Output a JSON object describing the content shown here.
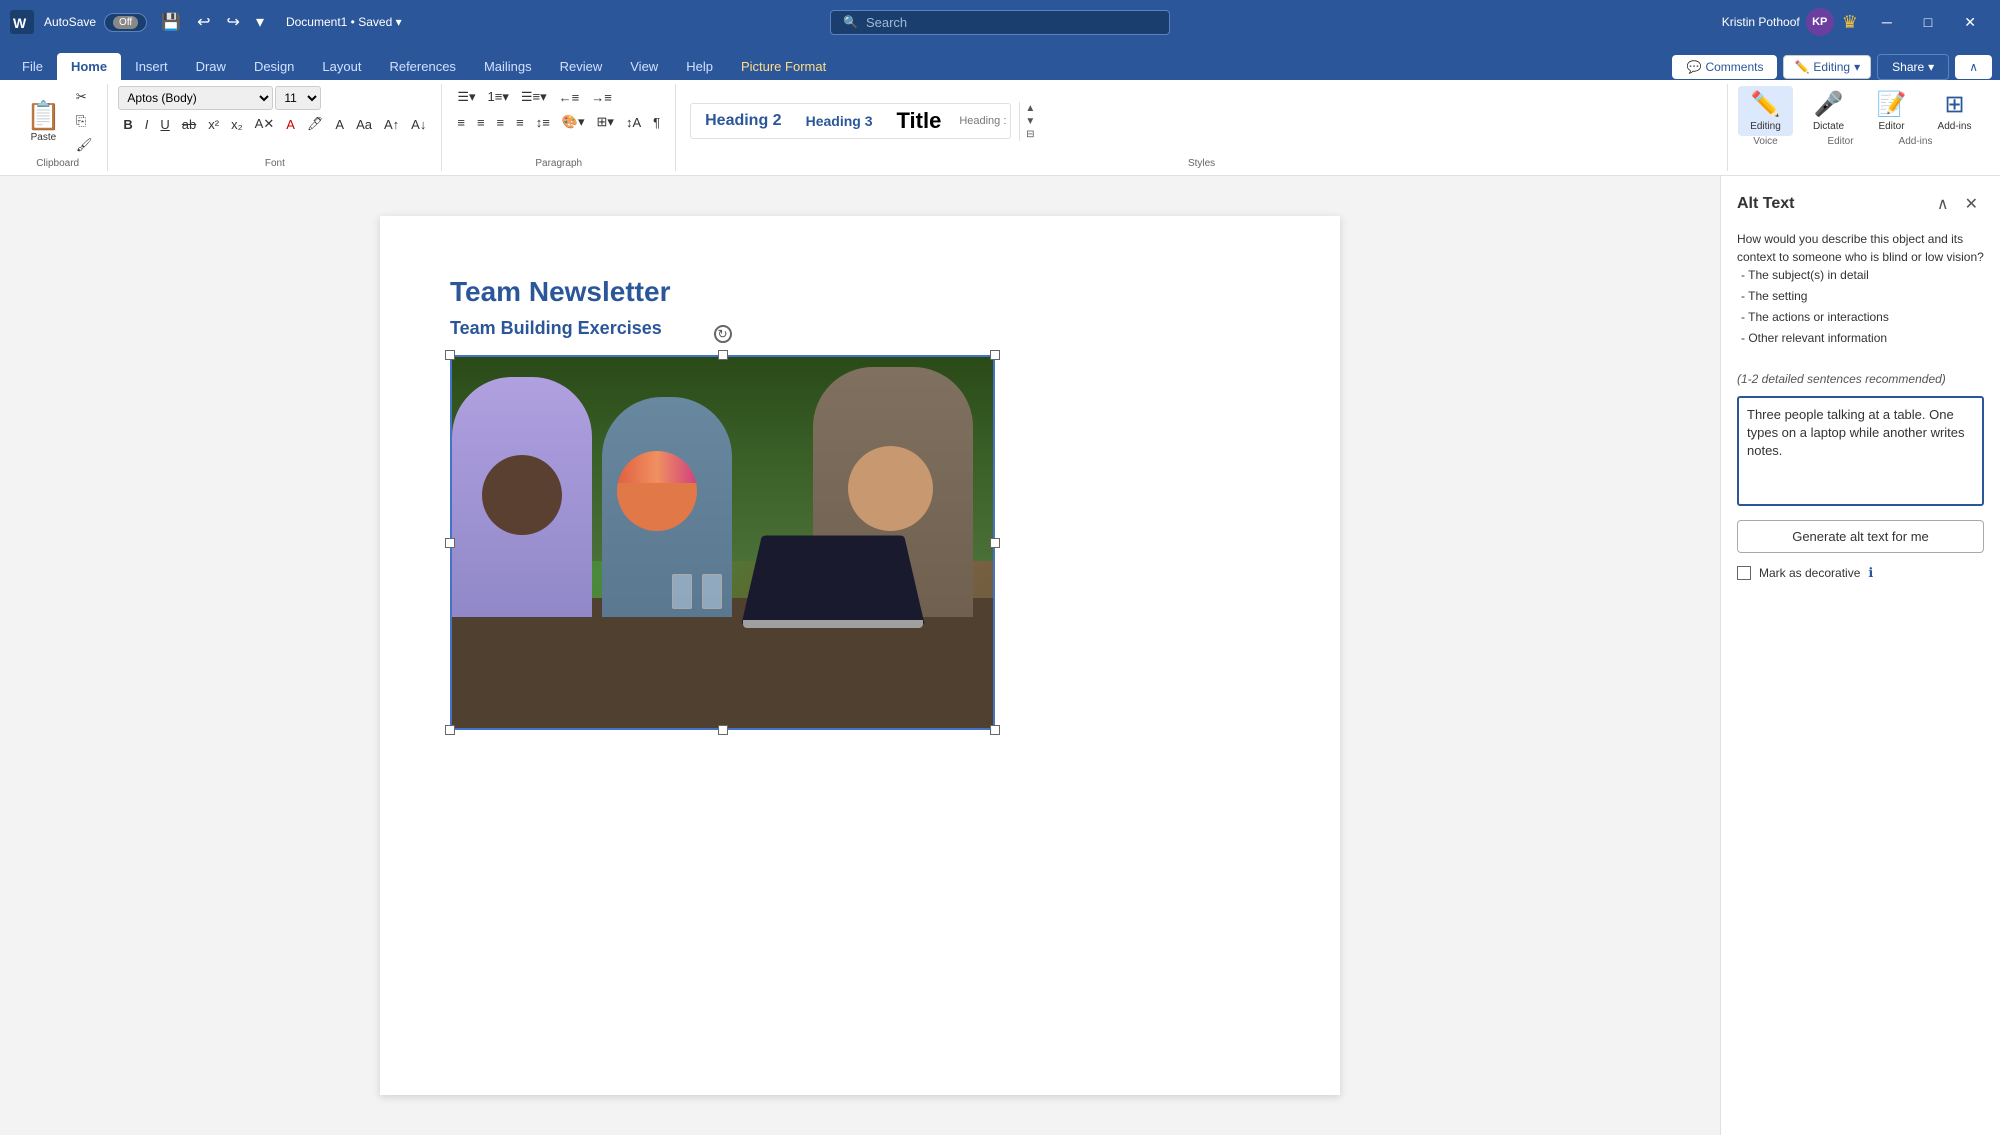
{
  "titlebar": {
    "autosave_label": "AutoSave",
    "toggle_label": "Off",
    "doc_name": "Document1",
    "doc_status": "Saved",
    "search_placeholder": "Search",
    "user_name": "Kristin Pothoof",
    "user_initials": "KP"
  },
  "tabs": {
    "items": [
      "File",
      "Home",
      "Insert",
      "Draw",
      "Design",
      "Layout",
      "References",
      "Mailings",
      "Review",
      "View",
      "Help",
      "Picture Format"
    ],
    "active": "Home",
    "highlighted": "Picture Format"
  },
  "ribbon": {
    "comments_label": "Comments",
    "editing_label": "Editing",
    "share_label": "Share",
    "font_name": "Aptos (Body)",
    "font_size": "11",
    "styles": [
      "Heading 2",
      "Heading 3",
      "Title"
    ],
    "groups": {
      "clipboard": "Clipboard",
      "font": "Font",
      "paragraph": "Paragraph",
      "styles": "Styles",
      "voice": "Voice",
      "editor": "Editor",
      "addins": "Add-ins"
    },
    "tools": {
      "editing_tool": "Editing",
      "dictate": "Dictate",
      "editor_tool": "Editor",
      "addins_tool": "Add-ins"
    }
  },
  "document": {
    "title": "Team Newsletter",
    "subtitle": "Team Building Exercises",
    "alt_text_content": "Three people talking at a table. One types on a laptop while another writes notes."
  },
  "alt_text_panel": {
    "title": "Alt Text",
    "description": "How would you describe this object and its context to someone who is blind or low vision?",
    "bullets": [
      "- The subject(s) in detail",
      "- The setting",
      "- The actions or interactions",
      "- Other relevant information"
    ],
    "hint": "(1-2 detailed sentences recommended)",
    "textarea_value": "Three people talking at a table. One types on a laptop while another writes notes.",
    "generate_btn": "Generate alt text for me",
    "decorative_label": "Mark as decorative"
  }
}
